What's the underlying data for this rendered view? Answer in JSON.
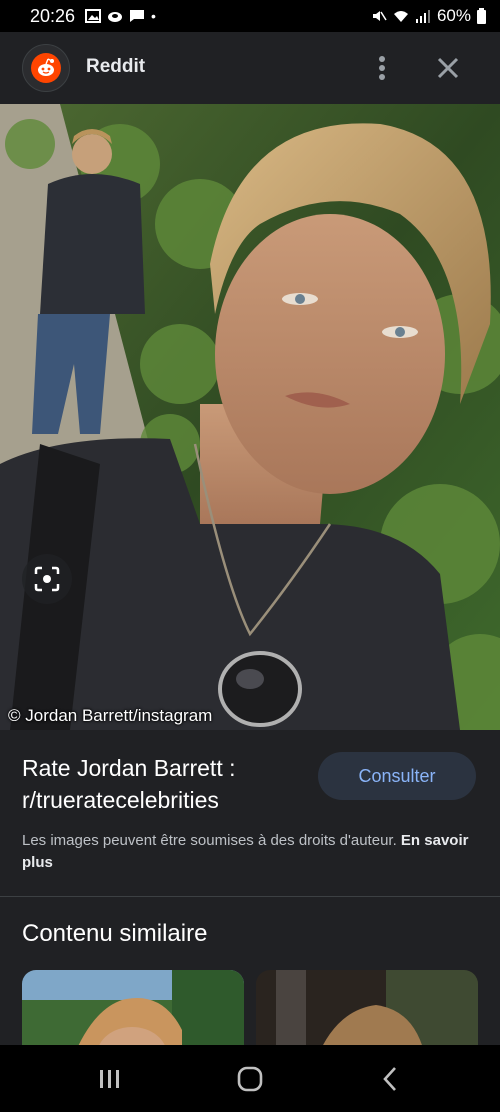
{
  "status_bar": {
    "time": "20:26",
    "battery": "60%"
  },
  "header": {
    "source_title": "Reddit",
    "logo_icon": "reddit-logo-icon",
    "menu_icon": "more-vert-icon",
    "close_icon": "close-icon"
  },
  "image": {
    "credit": "© Jordan Barrett/instagram",
    "lens_icon": "lens-search-icon"
  },
  "result": {
    "title": "Rate Jordan Barrett : r/trueratecelebrities",
    "visit_label": "Consulter",
    "copyright_text": "Les images peuvent être soumises à des droits d'auteur.",
    "learn_more": "En savoir plus"
  },
  "related": {
    "title": "Contenu similaire"
  },
  "colors": {
    "accent": "#8ab4f8",
    "reddit": "#ff4500",
    "background": "#202124"
  }
}
